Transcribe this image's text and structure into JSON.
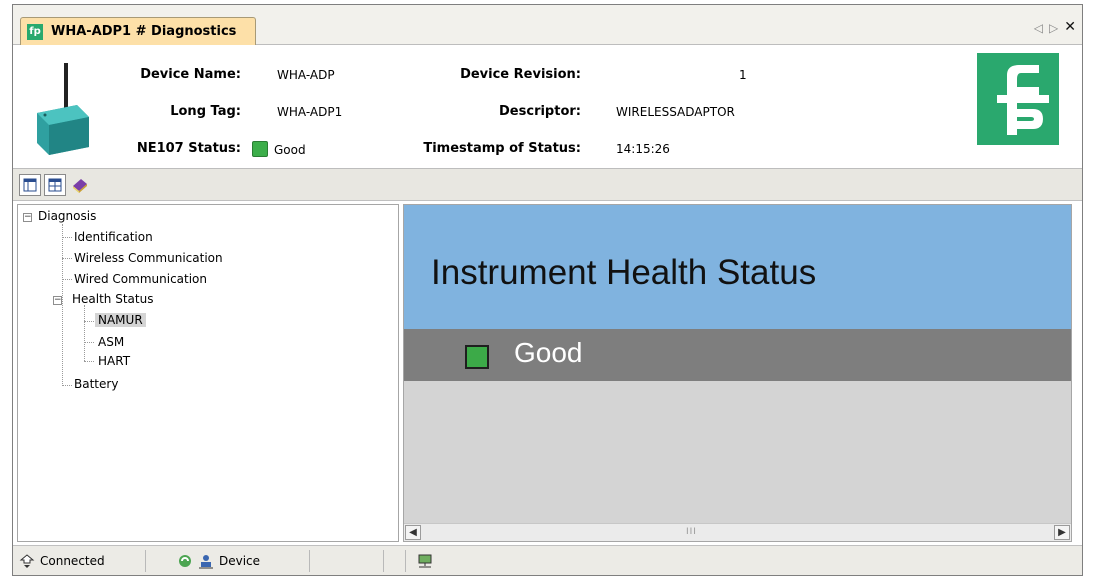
{
  "tab": {
    "title": "WHA-ADP1 # Diagnostics",
    "logo_text": "fp"
  },
  "header": {
    "device_name_label": "Device Name:",
    "device_name_value": "WHA-ADP",
    "long_tag_label": "Long Tag:",
    "long_tag_value": "WHA-ADP1",
    "ne107_label": "NE107 Status:",
    "ne107_value": "Good",
    "device_revision_label": "Device Revision:",
    "device_revision_value": "1",
    "descriptor_label": "Descriptor:",
    "descriptor_value": "WIRELESSADAPTOR",
    "timestamp_label": "Timestamp of Status:",
    "timestamp_value": "14:15:26"
  },
  "tree": {
    "root": "Diagnosis",
    "items": [
      "Identification",
      "Wireless Communication",
      "Wired Communication",
      "Health Status",
      "Battery"
    ],
    "health_children": [
      "NAMUR",
      "ASM",
      "HART"
    ],
    "selected": "NAMUR"
  },
  "panel": {
    "title": "Instrument Health Status",
    "status": "Good"
  },
  "statusbar": {
    "connection": "Connected",
    "device": "Device"
  },
  "colors": {
    "tab": "#fde0a8",
    "banner": "#80b3df",
    "status_band": "#7e7e7e",
    "good": "#3caa48",
    "brand": "#2aa86e"
  },
  "icons": [
    "pf-logo-icon",
    "close-icon",
    "prev-tab-icon",
    "next-tab-icon",
    "layout-icon",
    "table-icon",
    "book-icon",
    "connected-icon",
    "refresh-icon",
    "user-icon",
    "network-icon"
  ]
}
